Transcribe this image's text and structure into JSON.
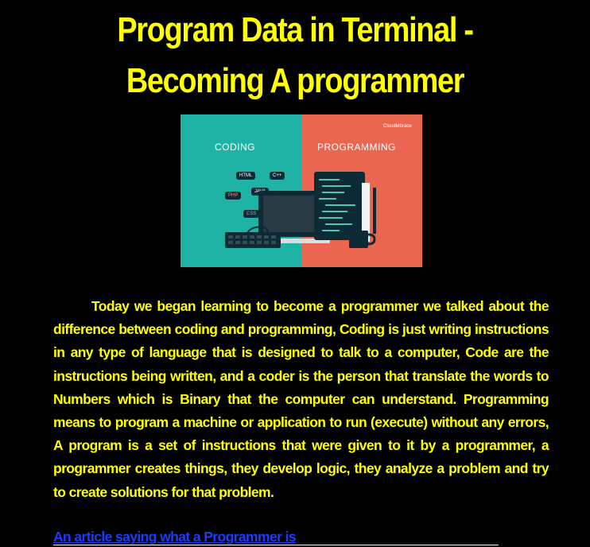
{
  "page": {
    "title_line1": "Program Data in Terminal -",
    "title_line2": "Becoming A programmer"
  },
  "hero_image": {
    "left_label": "CODING",
    "right_label": "PROGRAMMING",
    "logo": "CloudMbrace",
    "tags": [
      "HTML",
      "C++",
      "PHP",
      "JAVA",
      "CSS"
    ],
    "colors": {
      "left_panel": "#1fb3a6",
      "right_panel": "#ea6650"
    }
  },
  "article": {
    "paragraph": "Today we began learning to become a programmer we talked about the difference between coding and programming, Coding is just writing instructions in any type of language that is designed to talk to a computer, Code are the instructions being written, and a coder is the person that translate the words to Numbers which is Binary that the computer can understand. Programming means to program a machine or application to run (execute) without any errors,  A program is a set of instructions that were given to it by a programmer, a programmer creates things, they develop logic, they analyze a problem and try to create solutions for that problem.",
    "link_text": "An article saying what a Programmer is"
  },
  "colors": {
    "background": "#000000",
    "text": "#ffff00",
    "link": "#1a3cff"
  }
}
